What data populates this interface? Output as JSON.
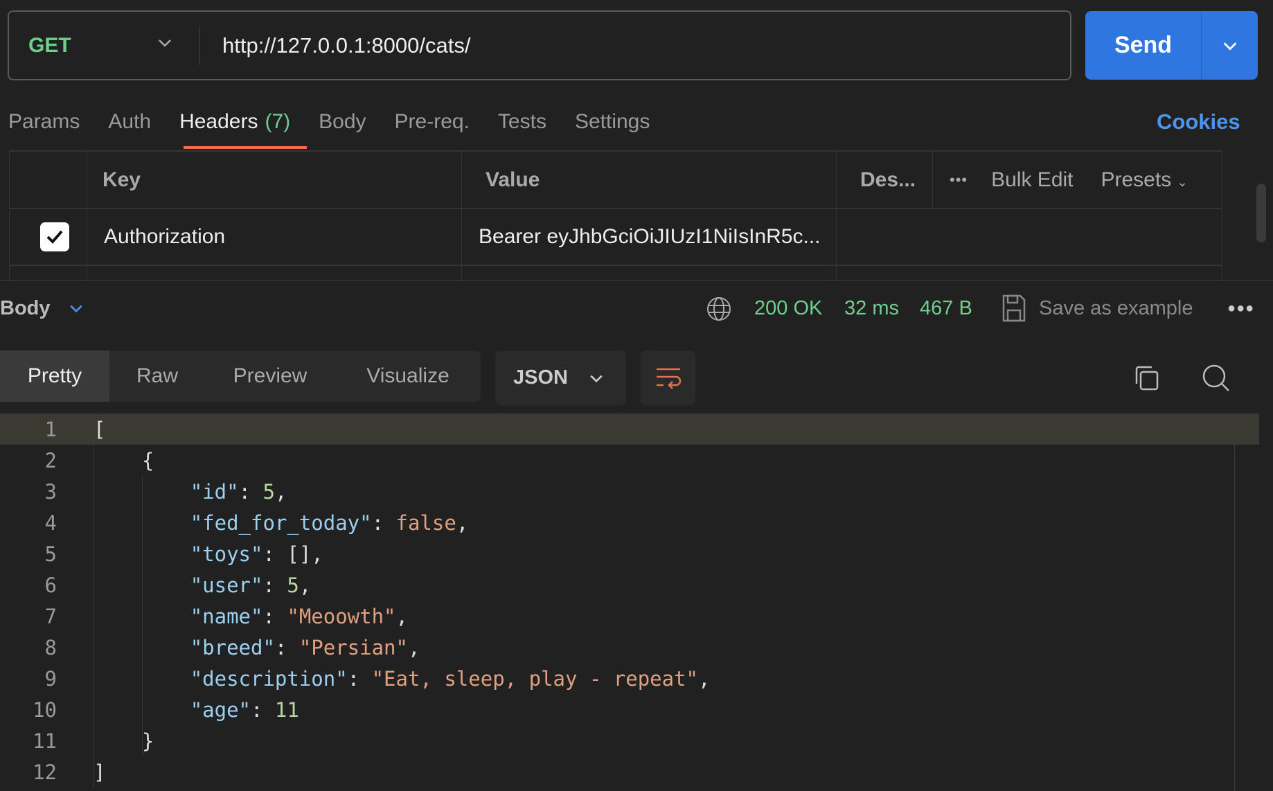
{
  "request": {
    "method": "GET",
    "url": "http://127.0.0.1:8000/cats/",
    "send_label": "Send"
  },
  "tabs": [
    {
      "label": "Params"
    },
    {
      "label": "Auth"
    },
    {
      "label": "Headers",
      "count": "(7)"
    },
    {
      "label": "Body"
    },
    {
      "label": "Pre-req."
    },
    {
      "label": "Tests"
    },
    {
      "label": "Settings"
    }
  ],
  "active_tab": "Headers",
  "cookies_label": "Cookies",
  "headers_table": {
    "columns": {
      "key": "Key",
      "value": "Value",
      "description": "Des...",
      "bulk_edit": "Bulk Edit",
      "presets": "Presets"
    },
    "rows": [
      {
        "checked": true,
        "key": "Authorization",
        "value": "Bearer eyJhbGciOiJIUzI1NiIsInR5c..."
      }
    ]
  },
  "response": {
    "section_label": "Body",
    "status": "200 OK",
    "time": "32 ms",
    "size": "467 B",
    "save_example": "Save as example",
    "view_tabs": [
      "Pretty",
      "Raw",
      "Preview",
      "Visualize"
    ],
    "active_view": "Pretty",
    "format": "JSON",
    "lines": [
      {
        "n": "1",
        "parts": [
          [
            "p",
            "["
          ]
        ]
      },
      {
        "n": "2",
        "parts": [
          [
            "p",
            "    {"
          ]
        ]
      },
      {
        "n": "3",
        "parts": [
          [
            "p",
            "        "
          ],
          [
            "k",
            "\"id\""
          ],
          [
            "p",
            ": "
          ],
          [
            "n",
            "5"
          ],
          [
            "p",
            ","
          ]
        ]
      },
      {
        "n": "4",
        "parts": [
          [
            "p",
            "        "
          ],
          [
            "k",
            "\"fed_for_today\""
          ],
          [
            "p",
            ": "
          ],
          [
            "b",
            "false"
          ],
          [
            "p",
            ","
          ]
        ]
      },
      {
        "n": "5",
        "parts": [
          [
            "p",
            "        "
          ],
          [
            "k",
            "\"toys\""
          ],
          [
            "p",
            ": [],"
          ]
        ]
      },
      {
        "n": "6",
        "parts": [
          [
            "p",
            "        "
          ],
          [
            "k",
            "\"user\""
          ],
          [
            "p",
            ": "
          ],
          [
            "n",
            "5"
          ],
          [
            "p",
            ","
          ]
        ]
      },
      {
        "n": "7",
        "parts": [
          [
            "p",
            "        "
          ],
          [
            "k",
            "\"name\""
          ],
          [
            "p",
            ": "
          ],
          [
            "s",
            "\"Meoowth\""
          ],
          [
            "p",
            ","
          ]
        ]
      },
      {
        "n": "8",
        "parts": [
          [
            "p",
            "        "
          ],
          [
            "k",
            "\"breed\""
          ],
          [
            "p",
            ": "
          ],
          [
            "s",
            "\"Persian\""
          ],
          [
            "p",
            ","
          ]
        ]
      },
      {
        "n": "9",
        "parts": [
          [
            "p",
            "        "
          ],
          [
            "k",
            "\"description\""
          ],
          [
            "p",
            ": "
          ],
          [
            "s",
            "\"Eat, sleep, play - repeat\""
          ],
          [
            "p",
            ","
          ]
        ]
      },
      {
        "n": "10",
        "parts": [
          [
            "p",
            "        "
          ],
          [
            "k",
            "\"age\""
          ],
          [
            "p",
            ": "
          ],
          [
            "n",
            "11"
          ]
        ]
      },
      {
        "n": "11",
        "parts": [
          [
            "p",
            "    }"
          ]
        ]
      },
      {
        "n": "12",
        "parts": [
          [
            "p",
            "]"
          ]
        ]
      }
    ]
  },
  "colors": {
    "accent": "#2f76e0",
    "success": "#6fcf8f",
    "tab_underline": "#e8704a",
    "link": "#4d94f0"
  }
}
